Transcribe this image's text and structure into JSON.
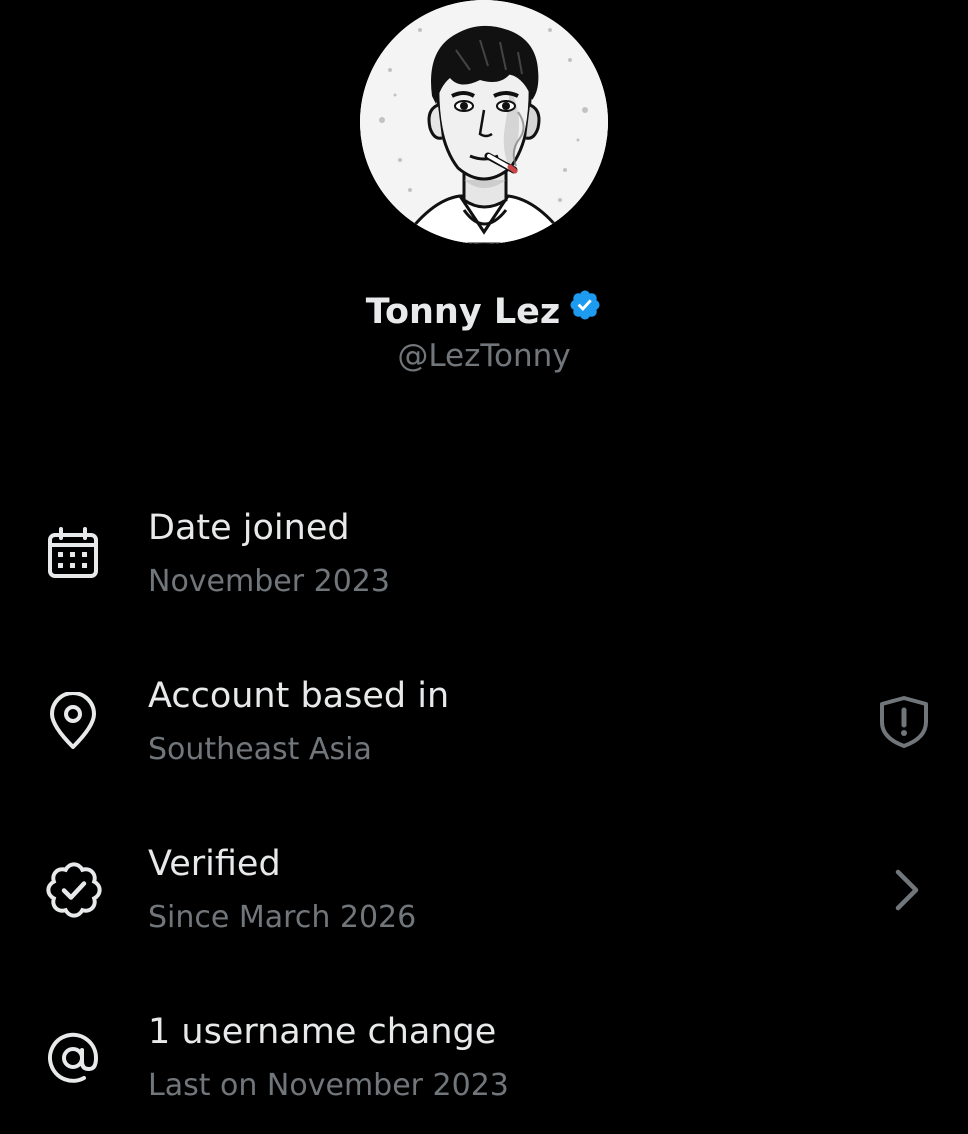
{
  "profile": {
    "display_name": "Tonny Lez",
    "handle": "@LezTonny",
    "verified_badge_color": "#1d9bf0"
  },
  "rows": [
    {
      "icon": "calendar-icon",
      "title": "Date joined",
      "subtitle": "November 2023"
    },
    {
      "icon": "location-pin-icon",
      "title": "Account based in",
      "subtitle": "Southeast Asia",
      "trailing_icon": "shield-alert-icon"
    },
    {
      "icon": "verified-badge-icon",
      "title": "Verified",
      "subtitle": "Since March 2026",
      "trailing_icon": "chevron-right-icon"
    },
    {
      "icon": "at-sign-icon",
      "title": "1 username change",
      "subtitle": "Last on November 2023"
    }
  ],
  "colors": {
    "background": "#000000",
    "primary_text": "#e7e9ea",
    "secondary_text": "#71767b"
  }
}
